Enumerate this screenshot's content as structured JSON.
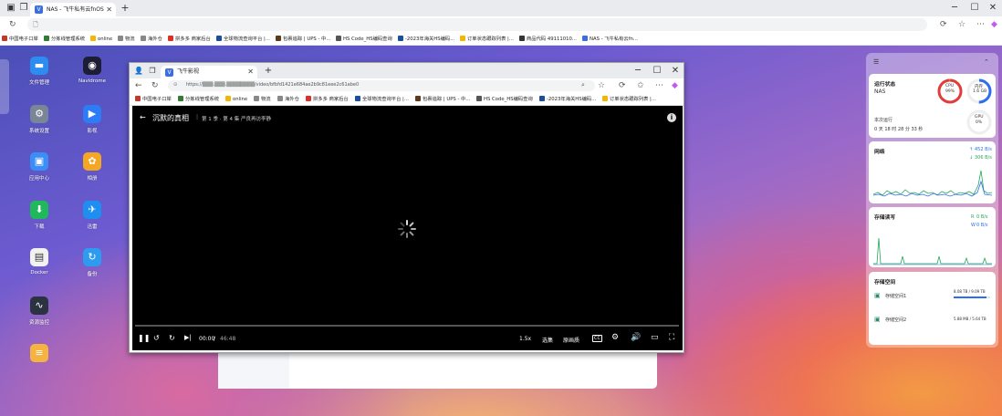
{
  "outer": {
    "tab_title": "NAS - 飞牛私有云fnOS",
    "new_tab": "+",
    "bookmarks": [
      {
        "label": "中国电子口岸",
        "color": "#c0392b"
      },
      {
        "label": "分拣线管理系统",
        "color": "#2e7d32"
      },
      {
        "label": "online",
        "color": "#f2b705"
      },
      {
        "label": "物流",
        "color": "#888888"
      },
      {
        "label": "海外仓",
        "color": "#888888"
      },
      {
        "label": "拼多多 商家后台",
        "color": "#e02e24"
      },
      {
        "label": "全球物流查询平台 |...",
        "color": "#1a4fa0"
      },
      {
        "label": "包裹追踪 | UPS - 中...",
        "color": "#5b3a1d"
      },
      {
        "label": "HS Code_HS编码查询",
        "color": "#555555"
      },
      {
        "label": "-2023年海关HS编码...",
        "color": "#1a4fa0"
      },
      {
        "label": "订单状态跟踪列表 |...",
        "color": "#f2b705"
      },
      {
        "label": "商品代码 49111010...",
        "color": "#333333"
      },
      {
        "label": "NAS - 飞牛私有云fn...",
        "color": "#3b6fe0"
      }
    ]
  },
  "desktop": {
    "icons": [
      {
        "label": "文件管理",
        "glyph": "▬",
        "bg": "#2d8cf0"
      },
      {
        "label": "Navidrome",
        "glyph": "◉",
        "bg": "#1d1d35"
      },
      {
        "label": "系统设置",
        "glyph": "⚙",
        "bg": "#7a8596"
      },
      {
        "label": "影视",
        "glyph": "▶",
        "bg": "#2b7cf6"
      },
      {
        "label": "应用中心",
        "glyph": "▣",
        "bg": "#3a8ef6"
      },
      {
        "label": "相册",
        "glyph": "✿",
        "bg": "#f5a623"
      },
      {
        "label": "下载",
        "glyph": "⬇",
        "bg": "#1fb85a"
      },
      {
        "label": "迅雷",
        "glyph": "✈",
        "bg": "#1e8ef0"
      },
      {
        "label": "Docker",
        "glyph": "▤",
        "bg": "#f2f2f2"
      },
      {
        "label": "备份",
        "glyph": "↻",
        "bg": "#2d9cf0"
      },
      {
        "label": "资源监控",
        "glyph": "∿",
        "bg": "#2b3340"
      },
      {
        "label": "",
        "glyph": "≡",
        "bg": "#f5b342"
      }
    ]
  },
  "widgets": {
    "status": {
      "title": "运行状态",
      "device": "NAS",
      "uptime_label": "本次运行",
      "uptime": "0 天 18 时 28 分 33 秒",
      "cpu": {
        "label": "CPU",
        "value": "99%",
        "fraction": 0.99
      },
      "mem": {
        "label": "内存",
        "value": "1.6 GB",
        "fraction": 0.5
      },
      "gpu": {
        "label": "GPU",
        "value": "0%",
        "fraction": 0.0
      }
    },
    "network": {
      "title": "网络",
      "up": "452 B/s",
      "down": "306 B/s",
      "up_icon": "↑",
      "down_icon": "↓"
    },
    "disk_io": {
      "title": "存储读写",
      "read_label": "R",
      "read": "0 B/s",
      "write_label": "W",
      "write": "0 B/s"
    },
    "storage": {
      "title": "存储空间",
      "items": [
        {
          "label": "存储空间1",
          "usage": "8.08 TB / 9.09 TB",
          "fraction": 0.89
        },
        {
          "label": "存储空间2",
          "usage": "5.88 MB / 5.64 TB",
          "fraction": 0.001
        }
      ]
    }
  },
  "inner": {
    "tab_title": "飞牛影视",
    "new_tab": "+",
    "url": "https://▒▒▒.▒▒▒.▒▒▒▒▒▒▒▒/video/bfbfd1421e684ae2b9c81eee2c61abe0",
    "bookmarks": [
      {
        "label": "中国电子口岸",
        "color": "#c0392b"
      },
      {
        "label": "分拣线管理系统",
        "color": "#2e7d32"
      },
      {
        "label": "online",
        "color": "#f2b705"
      },
      {
        "label": "物流",
        "color": "#888888"
      },
      {
        "label": "海外仓",
        "color": "#888888"
      },
      {
        "label": "拼多多 商家后台",
        "color": "#e02e24"
      },
      {
        "label": "全球物流查询平台 |...",
        "color": "#1a4fa0"
      },
      {
        "label": "包裹追踪 | UPS - 中...",
        "color": "#5b3a1d"
      },
      {
        "label": "HS Code_HS编码查询",
        "color": "#555555"
      },
      {
        "label": "-2023年海关HS编码...",
        "color": "#1a4fa0"
      },
      {
        "label": "订单状态跟踪列表 |...",
        "color": "#f2b705"
      }
    ]
  },
  "player": {
    "title": "沉默的真相",
    "subtitle": "第 1 季 · 第 4 集 严良再访李静",
    "time_current": "00:00",
    "time_sep": " / ",
    "time_total": "46:48",
    "speed": "1.5x",
    "episodes": "选集",
    "quality": "原画质",
    "cc": "CC"
  }
}
